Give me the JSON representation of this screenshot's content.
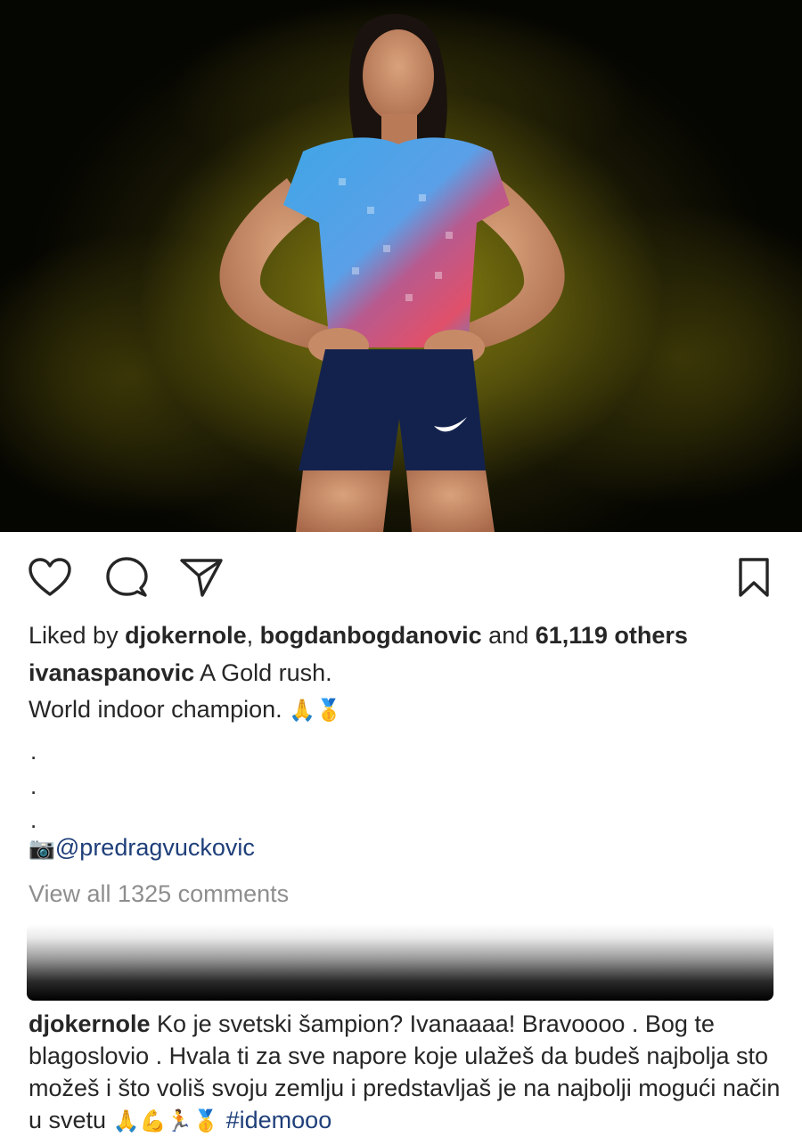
{
  "post": {
    "image_alt": "Athlete posing with hands on hips in front of a yellow dust background",
    "likes": {
      "prefix": "Liked by",
      "user1": "djokernole",
      "separator": ",",
      "user2": "bogdanbogdanovic",
      "conjunction": "and",
      "count_text": "61,119 others"
    },
    "caption": {
      "username": "ivanaspanovic",
      "line1": "A Gold rush.",
      "line2": "World indoor champion.",
      "line2_emoji": "🙏🥇",
      "dots": [
        ".",
        ".",
        "."
      ],
      "photo_credit_emoji": "📷",
      "photo_credit": "@predragvuckovic"
    },
    "view_all_comments": "View all 1325 comments",
    "comment": {
      "username": "djokernole",
      "text": "Ko je svetski šampion? Ivanaaaa! Bravoooo . Bog te blagoslovio . Hvala ti za sve napore koje ulažeš da budeš najbolja sto možeš i što voliš svoju zemlju i predstavljaš je na najbolji mogući način u svetu",
      "emoji": "🙏💪🏃🥇",
      "hashtag": "#idemooo"
    }
  },
  "icons": {
    "like": "heart-icon",
    "comment": "comment-bubble-icon",
    "share": "paper-plane-icon",
    "save": "bookmark-icon"
  },
  "colors": {
    "text": "#262626",
    "link": "#1f3f7a",
    "muted": "#8e8e8e",
    "photo_glow": "#948c12"
  }
}
